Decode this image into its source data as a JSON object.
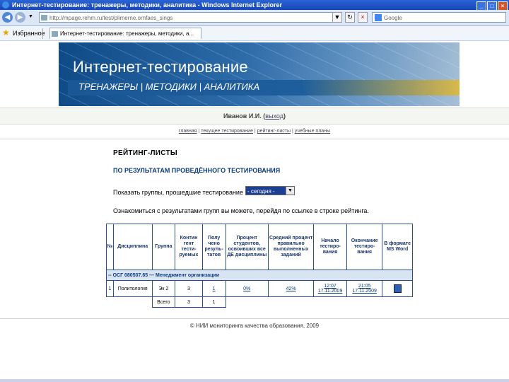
{
  "window": {
    "title": "Интернет-тестирование: тренажеры, методики, аналитика - Windows Internet Explorer"
  },
  "address": {
    "url": "http://mpage.rehm.ru/test/plimerne.ornfaes_sings",
    "search_placeholder": "Google"
  },
  "favorites": {
    "label": "Избранное",
    "tab_title": "Интернет-тестирование: тренажеры, методики, а..."
  },
  "banner": {
    "title": "Интернет-тестирование",
    "nav": [
      "ТРЕНАЖЕРЫ",
      "МЕТОДИКИ",
      "АНАЛИТИКА"
    ]
  },
  "user": {
    "name": "Иванов И.И.",
    "logout": "выход"
  },
  "menu": [
    "главная",
    "текущее тестирование",
    "рейтинг-листы",
    "учебные планы"
  ],
  "page": {
    "title": "РЕЙТИНГ-ЛИСТЫ",
    "subtitle": "ПО РЕЗУЛЬТАТАМ ПРОВЕДЁННОГО ТЕСТИРОВАНИЯ",
    "filter_label": "Показать группы, прошедшие тестирование",
    "filter_value": "- сегодня -",
    "note": "Ознакомиться с результатами групп вы можете, перейдя по ссылке в строке рейтинга."
  },
  "table": {
    "headers": [
      "№",
      "Дисциплина",
      "Группа",
      "Контин гент тести-руемых",
      "Полу чено резуль-татов",
      "Процент студентов, освоивших все ДЕ дисциплины",
      "Средний процент правильно выполненных заданий",
      "Начало тестиро-вания",
      "Окончание тестиро-вания",
      "В формате MS Word"
    ],
    "group": "-- ОСГ 080507.65 — Менеджмент организации",
    "rows": [
      {
        "n": "1",
        "discipline": "Политология",
        "group": "Эк 2",
        "contingent": "3",
        "results": "1",
        "percent_de": "0%",
        "avg_percent": "42%",
        "start": "12:07\n17.11.2009",
        "end": "21:05\n17.11.2009"
      }
    ],
    "total": {
      "label": "Всего",
      "contingent": "3",
      "results": "1"
    }
  },
  "footer": "© НИИ мониторинга качества образования, 2009"
}
